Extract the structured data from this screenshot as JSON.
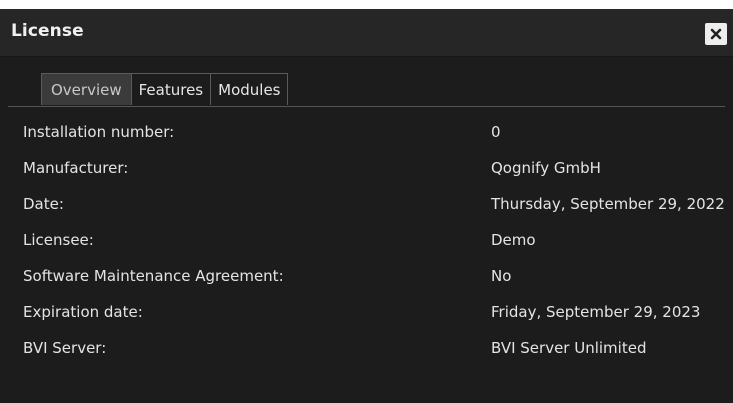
{
  "dialog": {
    "title": "License",
    "close_icon": "close-icon"
  },
  "tabs": [
    {
      "label": "Overview",
      "active": true
    },
    {
      "label": "Features",
      "active": false
    },
    {
      "label": "Modules",
      "active": false
    }
  ],
  "rows": [
    {
      "label": "Installation number:",
      "value": "0"
    },
    {
      "label": "Manufacturer:",
      "value": "Qognify GmbH"
    },
    {
      "label": "Date:",
      "value": "Thursday, September 29, 2022"
    },
    {
      "label": "Licensee:",
      "value": "Demo"
    },
    {
      "label": "Software Maintenance Agreement:",
      "value": "No"
    },
    {
      "label": "Expiration date:",
      "value": "Friday, September 29, 2023"
    },
    {
      "label": "BVI Server:",
      "value": "BVI Server Unlimited"
    }
  ]
}
